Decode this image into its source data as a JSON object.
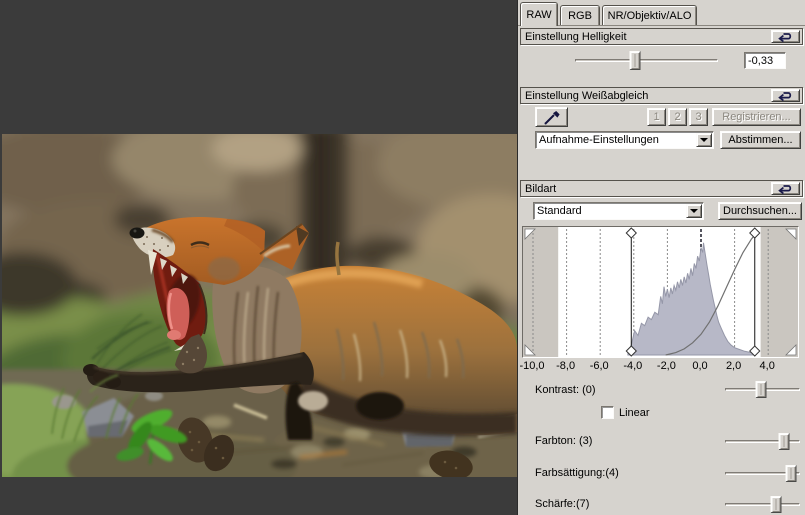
{
  "tabs": [
    {
      "label": "RAW",
      "active": true
    },
    {
      "label": "RGB",
      "active": false
    },
    {
      "label": "NR/Objektiv/ALO",
      "active": false
    }
  ],
  "brightness": {
    "title": "Einstellung Helligkeit",
    "value": "-0,33",
    "slider_percent": 42
  },
  "white_balance": {
    "title": "Einstellung Weißabgleich",
    "preset_buttons": [
      "1",
      "2",
      "3"
    ],
    "register_label": "Registrieren...",
    "dropdown_value": "Aufnahme-Einstellungen",
    "tune_label": "Abstimmen..."
  },
  "picture_style": {
    "title": "Bildart",
    "dropdown_value": "Standard",
    "browse_label": "Durchsuchen..."
  },
  "chart_data": {
    "type": "area",
    "title": "RAW brightness histogram with tone curve",
    "x_ticks": [
      -10,
      -8,
      -6,
      -4,
      -2,
      0,
      2,
      4
    ],
    "x_tick_labels": [
      "-10,0",
      "-8,0",
      "-6,0",
      "-4,0",
      "-2,0",
      "0,0",
      "2,0",
      "4,0"
    ],
    "x_range": [
      -10.5,
      5.0
    ],
    "ylim": [
      0,
      1
    ],
    "grid": "dashed-vertical",
    "shadow_marker": -4.15,
    "highlight_marker": 3.2,
    "gray_zone_left_end": -8.5,
    "gray_zone_right_start": 3.55,
    "histogram_points": [
      [
        -4.35,
        0.02
      ],
      [
        -4.15,
        0.08
      ],
      [
        -3.95,
        0.2
      ],
      [
        -3.75,
        0.16
      ],
      [
        -3.55,
        0.26
      ],
      [
        -3.35,
        0.24
      ],
      [
        -3.15,
        0.31
      ],
      [
        -2.95,
        0.29
      ],
      [
        -2.75,
        0.35
      ],
      [
        -2.55,
        0.33
      ],
      [
        -2.4,
        0.48
      ],
      [
        -2.3,
        0.42
      ],
      [
        -2.2,
        0.56
      ],
      [
        -2.1,
        0.48
      ],
      [
        -2.0,
        0.54
      ],
      [
        -1.9,
        0.47
      ],
      [
        -1.8,
        0.55
      ],
      [
        -1.7,
        0.5
      ],
      [
        -1.6,
        0.57
      ],
      [
        -1.5,
        0.53
      ],
      [
        -1.4,
        0.6
      ],
      [
        -1.3,
        0.55
      ],
      [
        -1.2,
        0.62
      ],
      [
        -1.1,
        0.57
      ],
      [
        -1.0,
        0.64
      ],
      [
        -0.9,
        0.59
      ],
      [
        -0.8,
        0.67
      ],
      [
        -0.7,
        0.62
      ],
      [
        -0.6,
        0.71
      ],
      [
        -0.5,
        0.65
      ],
      [
        -0.4,
        0.75
      ],
      [
        -0.3,
        0.71
      ],
      [
        -0.2,
        0.81
      ],
      [
        -0.1,
        0.77
      ],
      [
        0.0,
        0.88
      ],
      [
        0.1,
        0.84
      ],
      [
        0.15,
        0.92
      ],
      [
        0.25,
        0.83
      ],
      [
        0.35,
        0.74
      ],
      [
        0.45,
        0.66
      ],
      [
        0.55,
        0.58
      ],
      [
        0.65,
        0.51
      ],
      [
        0.75,
        0.44
      ],
      [
        0.85,
        0.38
      ],
      [
        0.95,
        0.32
      ],
      [
        1.05,
        0.27
      ],
      [
        1.2,
        0.22
      ],
      [
        1.4,
        0.16
      ],
      [
        1.6,
        0.11
      ],
      [
        1.8,
        0.08
      ],
      [
        2.0,
        0.06
      ],
      [
        2.3,
        0.045
      ],
      [
        2.6,
        0.03
      ],
      [
        3.0,
        0.02
      ],
      [
        3.2,
        0.015
      ]
    ],
    "tone_curve": [
      [
        -2.1,
        0.0
      ],
      [
        -1.5,
        0.02
      ],
      [
        -1.0,
        0.05
      ],
      [
        -0.5,
        0.1
      ],
      [
        0.0,
        0.17
      ],
      [
        0.5,
        0.27
      ],
      [
        1.0,
        0.4
      ],
      [
        1.5,
        0.55
      ],
      [
        2.0,
        0.7
      ],
      [
        2.5,
        0.84
      ],
      [
        3.0,
        0.95
      ],
      [
        3.3,
        1.0
      ]
    ]
  },
  "adjust": {
    "contrast": {
      "label": "Kontrast: (0)",
      "percent": 48
    },
    "linear": {
      "label": "Linear",
      "checked": false
    },
    "hue": {
      "label": "Farbton: (3)",
      "percent": 78
    },
    "saturation": {
      "label": "Farbsättigung:(4)",
      "percent": 88
    },
    "sharpness": {
      "label": "Schärfe:(7)",
      "percent": 68
    }
  },
  "icons": {
    "reset": "undo-arrow",
    "white_balance_picker": "eyedropper",
    "dropdown": "caret-down"
  },
  "colors": {
    "panel": "#d6d3ce",
    "canvas_background": "#3b3b3b",
    "histogram_fill": "#b7b8c7",
    "histogram_outline": "#9597a8",
    "gray_zone": "#cac6c0",
    "marker_line": "#141414",
    "reset_icon": "#1b1b4b",
    "disabled_text": "#8b877f"
  }
}
